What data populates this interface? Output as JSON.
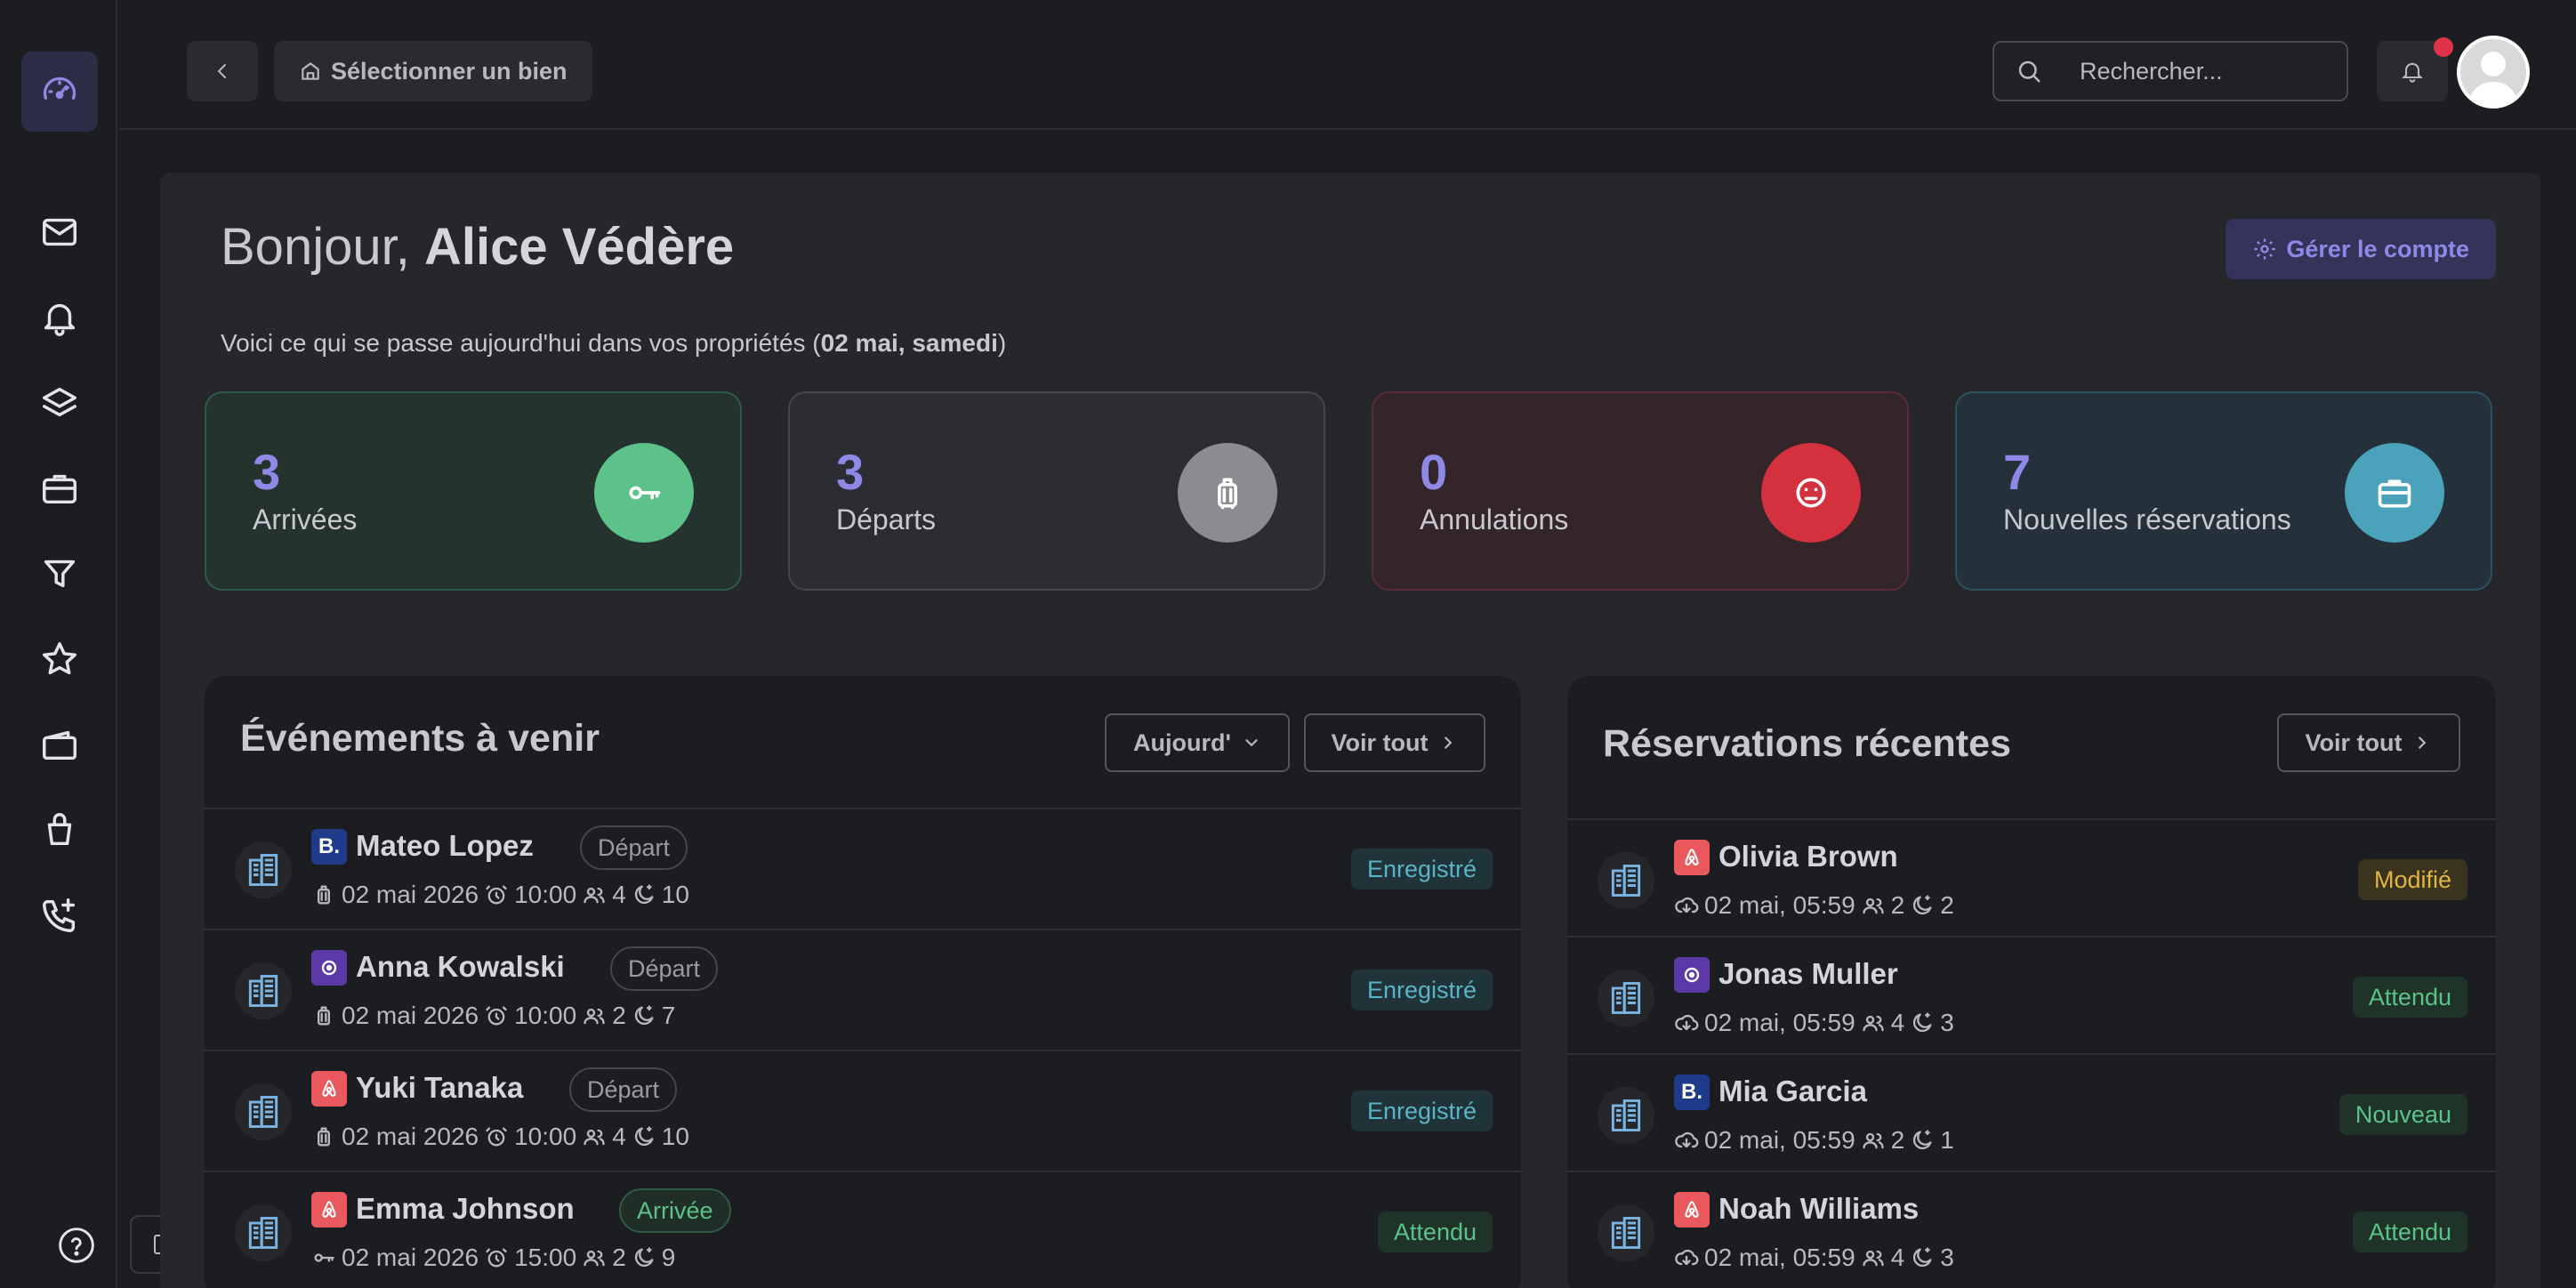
{
  "topbar": {
    "select_label": "Sélectionner un bien",
    "search_placeholder": "Rechercher..."
  },
  "header": {
    "greeting_prefix": "Bonjour, ",
    "user_name": "Alice Védère",
    "manage_label": "Gérer le compte",
    "subtitle_prefix": "Voici ce qui se passe aujourd'hui dans vos propriétés (",
    "subtitle_date": "02 mai, samedi",
    "subtitle_suffix": ")"
  },
  "stats": [
    {
      "value": "3",
      "label": "Arrivées",
      "icon": "key-icon",
      "color": "#5cc28a"
    },
    {
      "value": "3",
      "label": "Départs",
      "icon": "luggage-icon",
      "color": "#8c8c90"
    },
    {
      "value": "0",
      "label": "Annulations",
      "icon": "sad-face-icon",
      "color": "#d4313f"
    },
    {
      "value": "7",
      "label": "Nouvelles réservations",
      "icon": "briefcase-icon",
      "color": "#4aa3bb"
    }
  ],
  "events": {
    "title": "Événements à venir",
    "filter_label": "Aujourd'",
    "see_all_label": "Voir tout",
    "rows": [
      {
        "source": "booking",
        "name": "Mateo Lopez",
        "tag": "Départ",
        "date": "02 mai 2026",
        "time": "10:00",
        "guests": "4",
        "nights": "10",
        "status": "Enregistré"
      },
      {
        "source": "other",
        "name": "Anna Kowalski",
        "tag": "Départ",
        "date": "02 mai 2026",
        "time": "10:00",
        "guests": "2",
        "nights": "7",
        "status": "Enregistré"
      },
      {
        "source": "airbnb",
        "name": "Yuki Tanaka",
        "tag": "Départ",
        "date": "02 mai 2026",
        "time": "10:00",
        "guests": "4",
        "nights": "10",
        "status": "Enregistré"
      },
      {
        "source": "airbnb",
        "name": "Emma Johnson",
        "tag": "Arrivée",
        "date": "02 mai 2026",
        "time": "15:00",
        "guests": "2",
        "nights": "9",
        "status": "Attendu"
      }
    ]
  },
  "reservations": {
    "title": "Réservations récentes",
    "see_all_label": "Voir tout",
    "rows": [
      {
        "source": "airbnb",
        "name": "Olivia Brown",
        "date": "02 mai, 05:59",
        "guests": "2",
        "nights": "2",
        "status": "Modifié"
      },
      {
        "source": "other",
        "name": "Jonas Muller",
        "date": "02 mai, 05:59",
        "guests": "4",
        "nights": "3",
        "status": "Attendu"
      },
      {
        "source": "booking",
        "name": "Mia Garcia",
        "date": "02 mai, 05:59",
        "guests": "2",
        "nights": "1",
        "status": "Nouveau"
      },
      {
        "source": "airbnb",
        "name": "Noah Williams",
        "date": "02 mai, 05:59",
        "guests": "4",
        "nights": "3",
        "status": "Attendu"
      }
    ]
  }
}
